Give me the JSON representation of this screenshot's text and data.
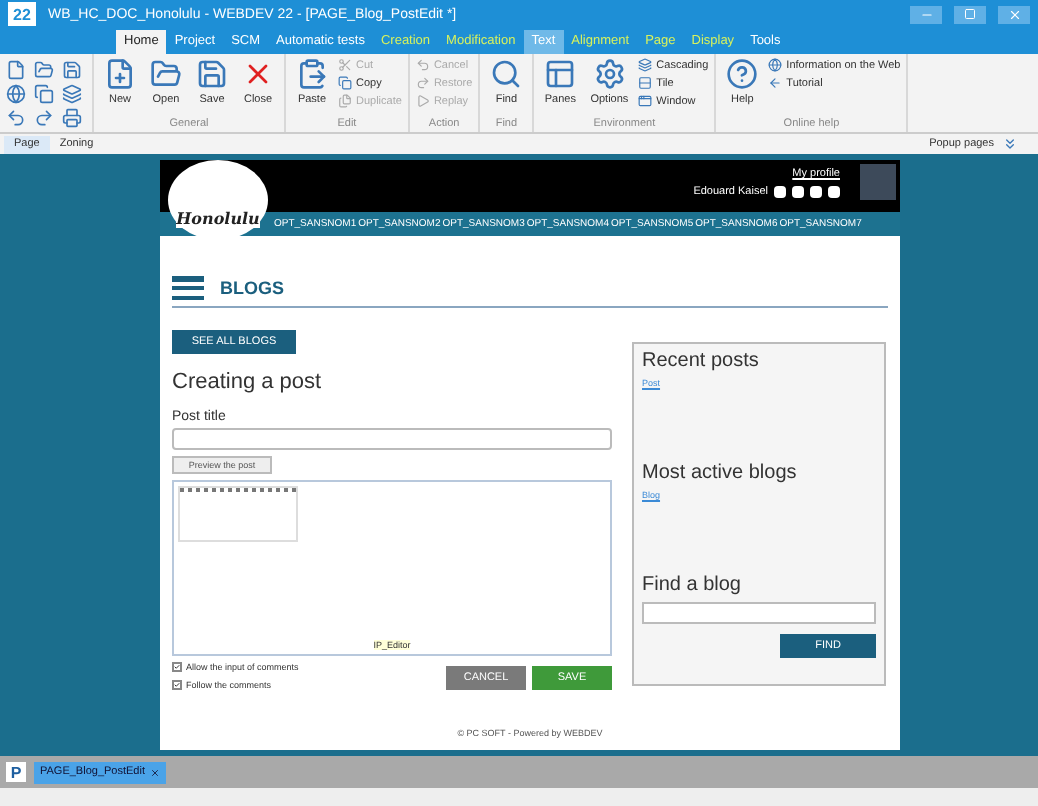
{
  "window": {
    "title": "WB_HC_DOC_Honolulu - WEBDEV 22 - [PAGE_Blog_PostEdit *]",
    "app_logo": "22"
  },
  "ribbon_tabs": [
    {
      "label": "Home",
      "selected": true,
      "kind": "standard"
    },
    {
      "label": "Project",
      "selected": false,
      "kind": "standard"
    },
    {
      "label": "SCM",
      "selected": false,
      "kind": "standard"
    },
    {
      "label": "Automatic tests",
      "selected": false,
      "kind": "standard"
    },
    {
      "label": "Creation",
      "selected": false,
      "kind": "contextual"
    },
    {
      "label": "Modification",
      "selected": false,
      "kind": "contextual"
    },
    {
      "label": "Text",
      "selected": false,
      "kind": "highlighted"
    },
    {
      "label": "Alignment",
      "selected": false,
      "kind": "contextual"
    },
    {
      "label": "Page",
      "selected": false,
      "kind": "contextual"
    },
    {
      "label": "Display",
      "selected": false,
      "kind": "contextual"
    },
    {
      "label": "Tools",
      "selected": false,
      "kind": "standard"
    }
  ],
  "ribbon_groups": [
    {
      "label": "General",
      "items": [
        {
          "label": "New",
          "kind": "large",
          "disabled": false
        },
        {
          "label": "Open",
          "kind": "large",
          "disabled": false
        },
        {
          "label": "Save",
          "kind": "large",
          "disabled": false
        },
        {
          "label": "Close",
          "kind": "large",
          "disabled": false
        }
      ]
    },
    {
      "label": "Edit",
      "items": [
        {
          "label": "Paste",
          "kind": "large",
          "disabled": false
        },
        {
          "label": "Cut",
          "kind": "small",
          "disabled": true
        },
        {
          "label": "Copy",
          "kind": "small",
          "disabled": false
        },
        {
          "label": "Duplicate",
          "kind": "small",
          "disabled": true
        }
      ]
    },
    {
      "label": "Action",
      "items": [
        {
          "label": "Cancel",
          "kind": "small",
          "disabled": true
        },
        {
          "label": "Restore",
          "kind": "small",
          "disabled": true
        },
        {
          "label": "Replay",
          "kind": "small",
          "disabled": true
        }
      ]
    },
    {
      "label": "Find",
      "items": [
        {
          "label": "Find",
          "kind": "large",
          "disabled": false
        }
      ]
    },
    {
      "label": "Environment",
      "items": [
        {
          "label": "Panes",
          "kind": "large",
          "disabled": false
        },
        {
          "label": "Options",
          "kind": "large",
          "disabled": false
        },
        {
          "label": "Cascading",
          "kind": "small",
          "disabled": false
        },
        {
          "label": "Tile",
          "kind": "small",
          "disabled": false
        },
        {
          "label": "Window",
          "kind": "small",
          "disabled": false
        }
      ]
    },
    {
      "label": "Online help",
      "items": [
        {
          "label": "Help",
          "kind": "large",
          "disabled": false
        },
        {
          "label": "Information on the Web",
          "kind": "small",
          "disabled": false
        },
        {
          "label": "Tutorial",
          "kind": "small",
          "disabled": false
        }
      ]
    }
  ],
  "view_tabs": [
    {
      "label": "Page",
      "selected": true
    },
    {
      "label": "Zoning",
      "selected": false
    }
  ],
  "popup_pages": "Popup pages",
  "page": {
    "header": {
      "logo_text": "Honolulu",
      "profile_link": "My profile",
      "user_name": "Edouard Kaisel"
    },
    "menu": [
      "OPT_SANSNOM1",
      "OPT_SANSNOM2",
      "OPT_SANSNOM3",
      "OPT_SANSNOM4",
      "OPT_SANSNOM5",
      "OPT_SANSNOM6",
      "OPT_SANSNOM7"
    ],
    "title": "BLOGS",
    "see_all_button": "SEE ALL BLOGS",
    "form": {
      "heading": "Creating a post",
      "post_title_label": "Post title",
      "preview_button": "Preview the post",
      "editor_label": "IP_Editor",
      "options": [
        {
          "label": "Allow the input of comments",
          "checked": true
        },
        {
          "label": "Follow the comments",
          "checked": true
        }
      ],
      "cancel_button": "CANCEL",
      "save_button": "SAVE"
    },
    "sidebar": {
      "sections": [
        {
          "heading": "Recent posts",
          "link": "Post"
        },
        {
          "heading": "Most active blogs",
          "link": "Blog"
        }
      ],
      "search_heading": "Find a blog",
      "find_button": "FIND"
    },
    "footer": "© PC SOFT - Powered by WEBDEV"
  },
  "document_bar_badge": "P",
  "document_tabs": [
    {
      "label": "PAGE_Blog_PostEdit",
      "selected": true
    }
  ]
}
